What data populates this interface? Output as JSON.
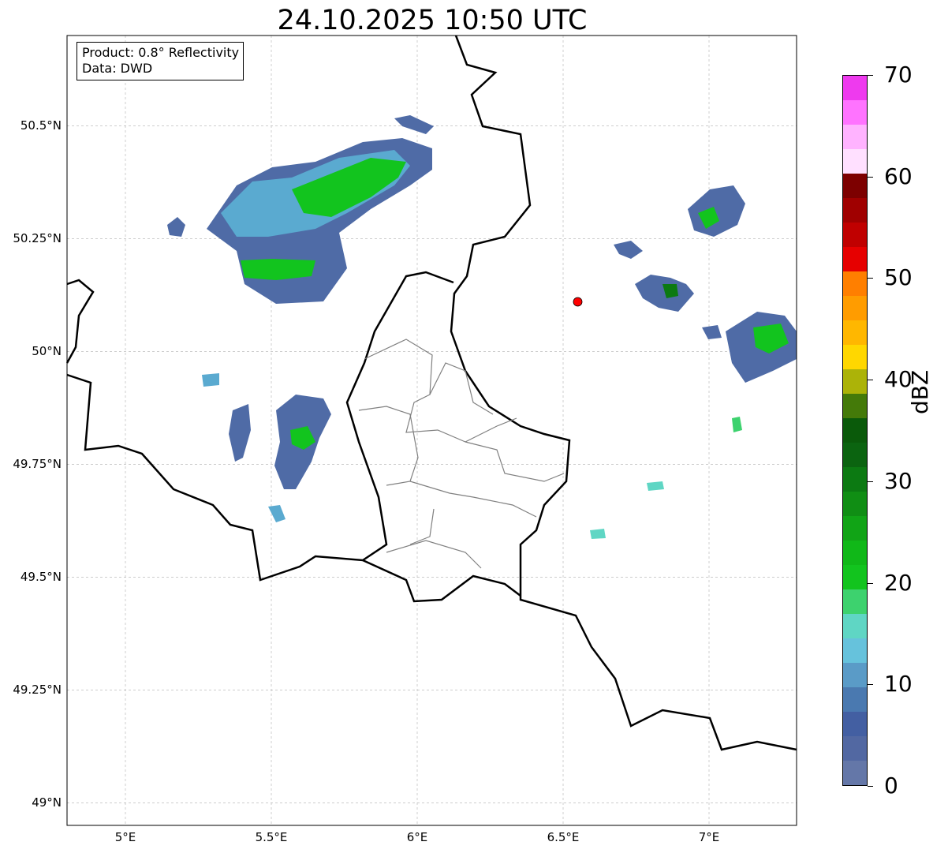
{
  "map": {
    "title": "24.10.2025 10:50 UTC",
    "info_lines": [
      "Product: 0.8° Reflectivity",
      "Data: DWD"
    ],
    "lon_range": [
      4.8,
      7.3
    ],
    "lat_range": [
      48.95,
      50.7
    ],
    "lat_ticks": [
      {
        "value": 50.5,
        "label": "50.5°N"
      },
      {
        "value": 50.25,
        "label": "50.25°N"
      },
      {
        "value": 50.0,
        "label": "50°N"
      },
      {
        "value": 49.75,
        "label": "49.75°N"
      },
      {
        "value": 49.5,
        "label": "49.5°N"
      },
      {
        "value": 49.25,
        "label": "49.25°N"
      },
      {
        "value": 49.0,
        "label": "49°N"
      }
    ],
    "lon_ticks": [
      {
        "value": 5.0,
        "label": "5°E"
      },
      {
        "value": 5.5,
        "label": "5.5°E"
      },
      {
        "value": 6.0,
        "label": "6°E"
      },
      {
        "value": 6.5,
        "label": "6.5°E"
      },
      {
        "value": 7.0,
        "label": "7°E"
      }
    ],
    "radar_site": {
      "lon": 6.55,
      "lat": 50.11,
      "color": "#ff0000"
    },
    "colorbar": {
      "label": "dBZ",
      "min": 0,
      "max": 70,
      "tick_values": [
        "0",
        "10",
        "20",
        "30",
        "40",
        "50",
        "60",
        "70"
      ],
      "colors": [
        "#6477a8",
        "#5268a2",
        "#435fa2",
        "#4a79b0",
        "#5a9bc7",
        "#66c2dc",
        "#5fd6c4",
        "#3dd26e",
        "#12c41e",
        "#10b818",
        "#11a416",
        "#108e14",
        "#0c7a12",
        "#0b6410",
        "#0a5a0a",
        "#447a09",
        "#acb308",
        "#ffd700",
        "#ffb700",
        "#ff9c00",
        "#ff7f00",
        "#e60000",
        "#c00000",
        "#a00000",
        "#7d0000",
        "#ffe0ff",
        "#ffb3ff",
        "#ff73ff",
        "#ee3aee"
      ]
    },
    "colors": {
      "grid": "#b0b0b0",
      "border": "#000000",
      "region_border": "#808080"
    }
  }
}
